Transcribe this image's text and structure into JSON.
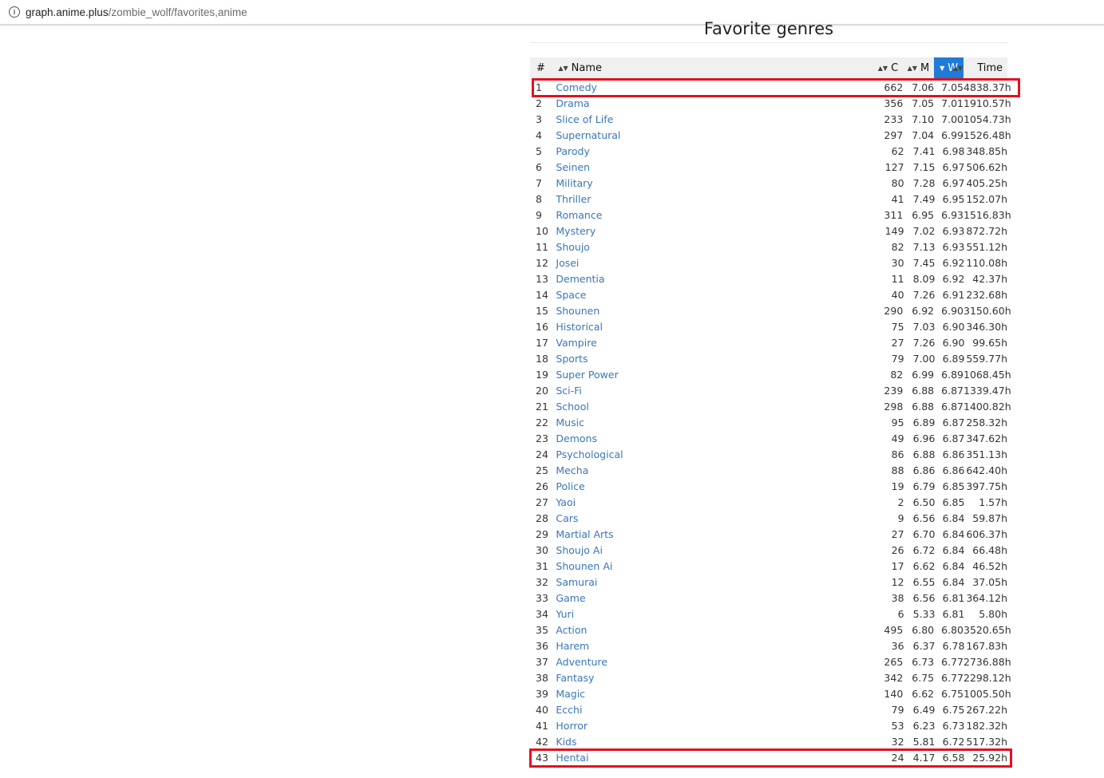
{
  "browser": {
    "url_host": "graph.anime.plus",
    "url_path": "/zombie_wolf/favorites,anime",
    "info_icon": "info-icon"
  },
  "section": {
    "title": "Favorite genres"
  },
  "table": {
    "headers": {
      "rank": "#",
      "name": "Name",
      "count": "C",
      "mean": "M",
      "weighted": "W",
      "time": "Time"
    },
    "active_sort_column": "W",
    "active_color": "#1f7bd8",
    "rows": [
      {
        "rank": "1",
        "name": "Comedy",
        "count": "662",
        "mean": "7.06",
        "weighted": "7.05",
        "time": "4838.37h"
      },
      {
        "rank": "2",
        "name": "Drama",
        "count": "356",
        "mean": "7.05",
        "weighted": "7.01",
        "time": "1910.57h"
      },
      {
        "rank": "3",
        "name": "Slice of Life",
        "count": "233",
        "mean": "7.10",
        "weighted": "7.00",
        "time": "1054.73h"
      },
      {
        "rank": "4",
        "name": "Supernatural",
        "count": "297",
        "mean": "7.04",
        "weighted": "6.99",
        "time": "1526.48h"
      },
      {
        "rank": "5",
        "name": "Parody",
        "count": "62",
        "mean": "7.41",
        "weighted": "6.98",
        "time": "348.85h"
      },
      {
        "rank": "6",
        "name": "Seinen",
        "count": "127",
        "mean": "7.15",
        "weighted": "6.97",
        "time": "506.62h"
      },
      {
        "rank": "7",
        "name": "Military",
        "count": "80",
        "mean": "7.28",
        "weighted": "6.97",
        "time": "405.25h"
      },
      {
        "rank": "8",
        "name": "Thriller",
        "count": "41",
        "mean": "7.49",
        "weighted": "6.95",
        "time": "152.07h"
      },
      {
        "rank": "9",
        "name": "Romance",
        "count": "311",
        "mean": "6.95",
        "weighted": "6.93",
        "time": "1516.83h"
      },
      {
        "rank": "10",
        "name": "Mystery",
        "count": "149",
        "mean": "7.02",
        "weighted": "6.93",
        "time": "872.72h"
      },
      {
        "rank": "11",
        "name": "Shoujo",
        "count": "82",
        "mean": "7.13",
        "weighted": "6.93",
        "time": "551.12h"
      },
      {
        "rank": "12",
        "name": "Josei",
        "count": "30",
        "mean": "7.45",
        "weighted": "6.92",
        "time": "110.08h"
      },
      {
        "rank": "13",
        "name": "Dementia",
        "count": "11",
        "mean": "8.09",
        "weighted": "6.92",
        "time": "42.37h"
      },
      {
        "rank": "14",
        "name": "Space",
        "count": "40",
        "mean": "7.26",
        "weighted": "6.91",
        "time": "232.68h"
      },
      {
        "rank": "15",
        "name": "Shounen",
        "count": "290",
        "mean": "6.92",
        "weighted": "6.90",
        "time": "3150.60h"
      },
      {
        "rank": "16",
        "name": "Historical",
        "count": "75",
        "mean": "7.03",
        "weighted": "6.90",
        "time": "346.30h"
      },
      {
        "rank": "17",
        "name": "Vampire",
        "count": "27",
        "mean": "7.26",
        "weighted": "6.90",
        "time": "99.65h"
      },
      {
        "rank": "18",
        "name": "Sports",
        "count": "79",
        "mean": "7.00",
        "weighted": "6.89",
        "time": "559.77h"
      },
      {
        "rank": "19",
        "name": "Super Power",
        "count": "82",
        "mean": "6.99",
        "weighted": "6.89",
        "time": "1068.45h"
      },
      {
        "rank": "20",
        "name": "Sci-Fi",
        "count": "239",
        "mean": "6.88",
        "weighted": "6.87",
        "time": "1339.47h"
      },
      {
        "rank": "21",
        "name": "School",
        "count": "298",
        "mean": "6.88",
        "weighted": "6.87",
        "time": "1400.82h"
      },
      {
        "rank": "22",
        "name": "Music",
        "count": "95",
        "mean": "6.89",
        "weighted": "6.87",
        "time": "258.32h"
      },
      {
        "rank": "23",
        "name": "Demons",
        "count": "49",
        "mean": "6.96",
        "weighted": "6.87",
        "time": "347.62h"
      },
      {
        "rank": "24",
        "name": "Psychological",
        "count": "86",
        "mean": "6.88",
        "weighted": "6.86",
        "time": "351.13h"
      },
      {
        "rank": "25",
        "name": "Mecha",
        "count": "88",
        "mean": "6.86",
        "weighted": "6.86",
        "time": "642.40h"
      },
      {
        "rank": "26",
        "name": "Police",
        "count": "19",
        "mean": "6.79",
        "weighted": "6.85",
        "time": "397.75h"
      },
      {
        "rank": "27",
        "name": "Yaoi",
        "count": "2",
        "mean": "6.50",
        "weighted": "6.85",
        "time": "1.57h"
      },
      {
        "rank": "28",
        "name": "Cars",
        "count": "9",
        "mean": "6.56",
        "weighted": "6.84",
        "time": "59.87h"
      },
      {
        "rank": "29",
        "name": "Martial Arts",
        "count": "27",
        "mean": "6.70",
        "weighted": "6.84",
        "time": "606.37h"
      },
      {
        "rank": "30",
        "name": "Shoujo Ai",
        "count": "26",
        "mean": "6.72",
        "weighted": "6.84",
        "time": "66.48h"
      },
      {
        "rank": "31",
        "name": "Shounen Ai",
        "count": "17",
        "mean": "6.62",
        "weighted": "6.84",
        "time": "46.52h"
      },
      {
        "rank": "32",
        "name": "Samurai",
        "count": "12",
        "mean": "6.55",
        "weighted": "6.84",
        "time": "37.05h"
      },
      {
        "rank": "33",
        "name": "Game",
        "count": "38",
        "mean": "6.56",
        "weighted": "6.81",
        "time": "364.12h"
      },
      {
        "rank": "34",
        "name": "Yuri",
        "count": "6",
        "mean": "5.33",
        "weighted": "6.81",
        "time": "5.80h"
      },
      {
        "rank": "35",
        "name": "Action",
        "count": "495",
        "mean": "6.80",
        "weighted": "6.80",
        "time": "3520.65h"
      },
      {
        "rank": "36",
        "name": "Harem",
        "count": "36",
        "mean": "6.37",
        "weighted": "6.78",
        "time": "167.83h"
      },
      {
        "rank": "37",
        "name": "Adventure",
        "count": "265",
        "mean": "6.73",
        "weighted": "6.77",
        "time": "2736.88h"
      },
      {
        "rank": "38",
        "name": "Fantasy",
        "count": "342",
        "mean": "6.75",
        "weighted": "6.77",
        "time": "2298.12h"
      },
      {
        "rank": "39",
        "name": "Magic",
        "count": "140",
        "mean": "6.62",
        "weighted": "6.75",
        "time": "1005.50h"
      },
      {
        "rank": "40",
        "name": "Ecchi",
        "count": "79",
        "mean": "6.49",
        "weighted": "6.75",
        "time": "267.22h"
      },
      {
        "rank": "41",
        "name": "Horror",
        "count": "53",
        "mean": "6.23",
        "weighted": "6.73",
        "time": "182.32h"
      },
      {
        "rank": "42",
        "name": "Kids",
        "count": "32",
        "mean": "5.81",
        "weighted": "6.72",
        "time": "517.32h"
      },
      {
        "rank": "43",
        "name": "Hentai",
        "count": "24",
        "mean": "4.17",
        "weighted": "6.58",
        "time": "25.92h"
      }
    ]
  },
  "annotations": {
    "highlight_color": "#e3111d",
    "highlighted_ranks": [
      "1",
      "43"
    ]
  }
}
